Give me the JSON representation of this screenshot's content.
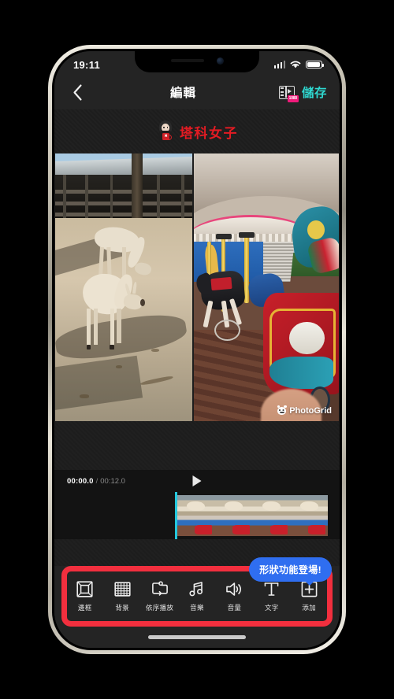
{
  "device": {
    "status_bar": {
      "time": "19:11",
      "icons": [
        "signal-bars-icon",
        "wifi-icon",
        "battery-icon"
      ]
    },
    "home_indicator": "home-indicator"
  },
  "navbar": {
    "back_icon": "back-chevron-icon",
    "title": "編輯",
    "export_icon": "export-video-icon",
    "export_badge": "1080",
    "save_label": "儲存",
    "save_color": "#2fd8d0"
  },
  "watermark": {
    "avatar_icon": "author-avatar-icon",
    "text": "塔科女子",
    "text_color": "#e31b23"
  },
  "collage": {
    "left_pane": {
      "name": "photo-alpaca-farm",
      "description": "兩隻羊駝在農場"
    },
    "right_pane": {
      "name": "photo-carousel-ride",
      "description": "旋轉木馬遊樂設施",
      "watermark_text": "PhotoGrid",
      "watermark_icon": "photogrid-logo-icon"
    }
  },
  "player": {
    "current_time": "00:00.0",
    "separator": "/",
    "total_time": "00:12.0",
    "play_icon": "play-icon",
    "playhead_color": "#24c8dd"
  },
  "timeline": {
    "clips": [
      {
        "name": "clip-thumbnail",
        "kind": "farm"
      },
      {
        "name": "clip-thumbnail",
        "kind": "farm"
      },
      {
        "name": "clip-thumbnail",
        "kind": "farm"
      },
      {
        "name": "clip-thumbnail",
        "kind": "farm"
      }
    ]
  },
  "tooltip": {
    "text": "形狀功能登場!",
    "color": "#2f6ef0"
  },
  "annotation": {
    "highlight_color": "#f22f3e",
    "target": "bottom-toolbar"
  },
  "toolbar": {
    "items": [
      {
        "label": "邊框",
        "icon": "frame-icon"
      },
      {
        "label": "背景",
        "icon": "grid-background-icon"
      },
      {
        "label": "依序播放",
        "icon": "sequence-play-icon"
      },
      {
        "label": "音樂",
        "icon": "music-note-icon"
      },
      {
        "label": "音量",
        "icon": "volume-speaker-icon"
      },
      {
        "label": "文字",
        "icon": "text-t-icon"
      },
      {
        "label": "添加",
        "icon": "add-plus-icon"
      }
    ]
  }
}
